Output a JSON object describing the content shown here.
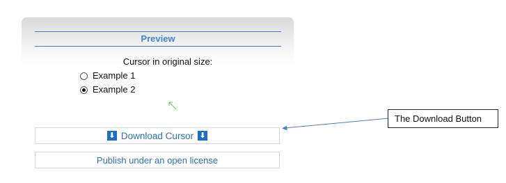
{
  "preview": {
    "title": "Preview",
    "cursor_label": "Cursor in original size:",
    "options": [
      {
        "label": "Example 1",
        "checked": false
      },
      {
        "label": "Example 2",
        "checked": true
      }
    ]
  },
  "buttons": {
    "download_label": "Download Cursor",
    "download_icon": "download-arrow-icon",
    "publish_label": "Publish under an open license"
  },
  "annotation": {
    "callout_text": "The Download Button"
  },
  "colors": {
    "accent": "#3d86cc",
    "download_icon_bg": "#1f6fc0",
    "link_text": "#2e6fb3",
    "preview_cursor": "#4cd13a",
    "annotation_arrow": "#4a7fc1"
  }
}
